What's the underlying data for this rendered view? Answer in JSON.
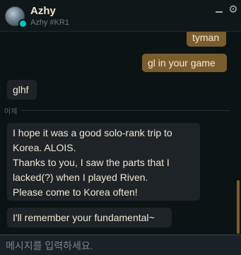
{
  "header": {
    "name": "Azhy",
    "tag": "Azhy #KR1",
    "minimize_icon": "minimize-icon",
    "settings_icon": "gear-icon",
    "status_color": "#0ac8b9"
  },
  "messages": [
    {
      "from": "me",
      "text": "tyman"
    },
    {
      "from": "me",
      "text": "gl in your game"
    },
    {
      "from": "them",
      "text": "glhf"
    },
    {
      "from": "them",
      "lines": [
        "I hope it was a good solo-rank trip to",
        "Korea. ALOIS.",
        "Thanks to you, I saw the parts that I",
        "lacked(?) when I played Riven.",
        "Please come to Korea often!"
      ]
    },
    {
      "from": "them",
      "text": "I'll remember your fundamental~"
    }
  ],
  "divider": {
    "label": "어제"
  },
  "input": {
    "placeholder": "메시지를 입력하세요.",
    "value": ""
  },
  "colors": {
    "my_bubble": "#7a5d2e",
    "their_bubble": "#1e2328",
    "background": "#0c1315"
  }
}
